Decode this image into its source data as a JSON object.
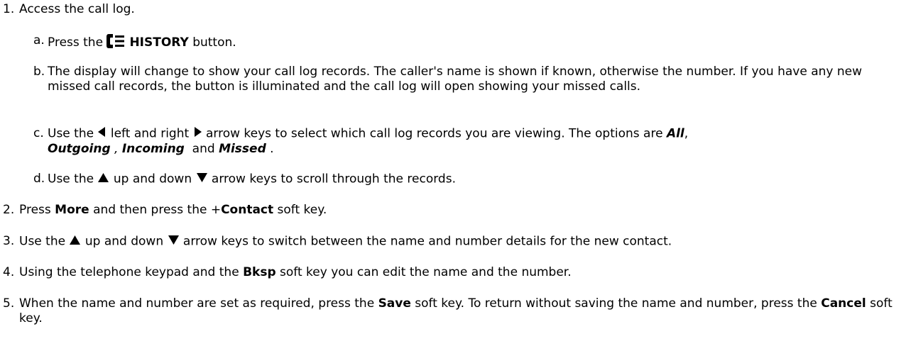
{
  "steps": [
    {
      "num": "1.",
      "text": "Access the call log.",
      "substeps": [
        {
          "num": "a.",
          "pre": "Press the",
          "icon": "history-icon",
          "bold": "HISTORY",
          "post": "button."
        },
        {
          "num": "b.",
          "text": "The display will change to show your call log records. The caller's name is shown if known, otherwise the number. If you have any new missed call records, the button is illuminated and the call log will open showing your missed calls."
        },
        {
          "num": "c.",
          "p1": "Use the",
          "icon_left": "left-arrow-icon",
          "p2": "left and right",
          "icon_right": "right-arrow-icon",
          "p3": "arrow keys to select which call log records you are viewing. The options are",
          "opt1": "All",
          "sep1": ",",
          "opt2": "Outgoing",
          "sep2": " ,",
          "opt3": "Incoming",
          "sep3": "and",
          "opt4": "Missed",
          "end": "."
        },
        {
          "num": "d.",
          "p1": "Use the",
          "icon_up": "up-arrow-icon",
          "p2": "up and down",
          "icon_down": "down-arrow-icon",
          "p3": "arrow keys to scroll through the records."
        }
      ]
    },
    {
      "num": "2.",
      "p1": "Press",
      "b1": "More",
      "p2": "and then press the +",
      "b2": "Contact",
      "p3": "soft key."
    },
    {
      "num": "3.",
      "p1": "Use the",
      "icon_up": "up-arrow-icon",
      "p2": "up and down",
      "icon_down": "down-arrow-icon",
      "p3": "arrow keys to switch between the name and number details for the new contact."
    },
    {
      "num": "4.",
      "p1": "Using the telephone keypad and the",
      "b1": "Bksp",
      "p2": "soft key you can edit the name and the number."
    },
    {
      "num": "5.",
      "p1": "When the name and number are set as required, press the",
      "b1": "Save",
      "p2": "soft key. To return without saving the name and number, press the",
      "b2": "Cancel",
      "p3": "soft key."
    }
  ]
}
